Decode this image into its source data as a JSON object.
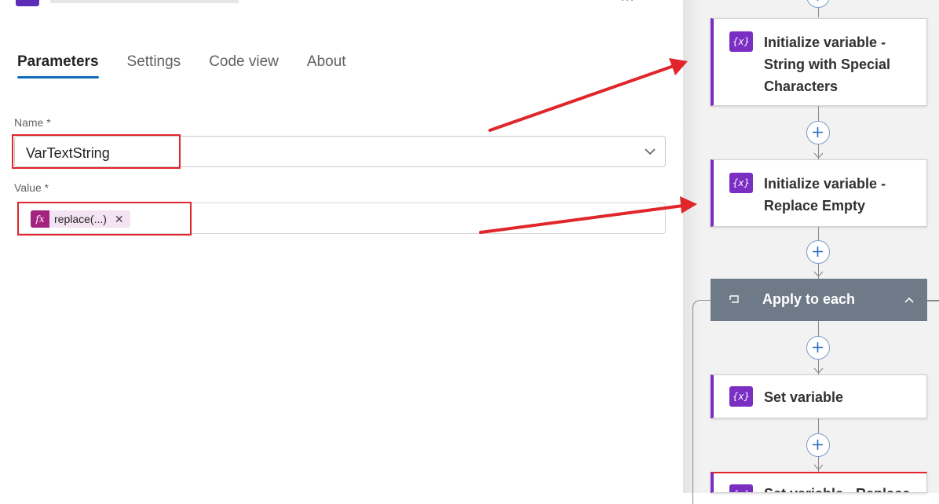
{
  "panel": {
    "tabs": [
      {
        "label": "Parameters"
      },
      {
        "label": "Settings"
      },
      {
        "label": "Code view"
      },
      {
        "label": "About"
      }
    ],
    "name_label": "Name *",
    "name_value": "VarTextString",
    "value_label": "Value *",
    "value_token": {
      "icon_text": "fx",
      "label": "replace(...)",
      "close": "✕"
    }
  },
  "flow": {
    "variable_icon_text": "{x}",
    "steps": [
      {
        "title_lines": [
          "Initialize variable -",
          "String with Special",
          "Characters"
        ]
      },
      {
        "title_lines": [
          "Initialize variable -",
          "Replace Empty"
        ]
      },
      {
        "title": "Apply to each"
      },
      {
        "title": "Set variable"
      },
      {
        "title": "Set variable - Replace"
      }
    ]
  },
  "colors": {
    "accent": "#0f6cbd",
    "variable_purple": "#7a2ec2",
    "token_magenta": "#a4237e",
    "highlight_red": "#e0262a",
    "loop_header": "#6e7a87"
  }
}
